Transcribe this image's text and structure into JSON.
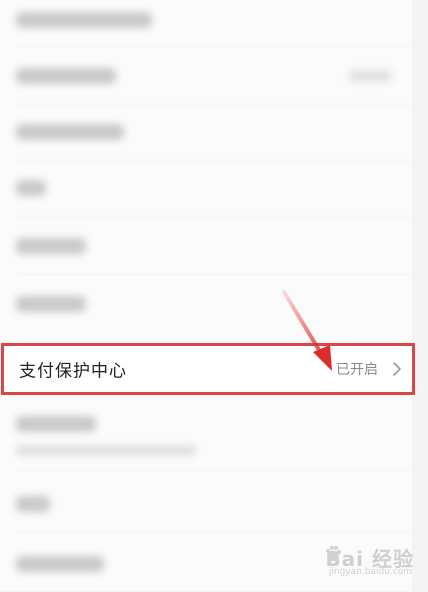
{
  "settings": {
    "highlighted_item": {
      "label": "支付保护中心",
      "status": "已开启"
    }
  },
  "watermark": {
    "brand": "Bai  经验",
    "url": "jingyan.baidu.com"
  },
  "colors": {
    "highlight_border": "#e04545",
    "arrow": "#e02b2b",
    "status_text": "#8a8a8a"
  },
  "icons": {
    "chevron": "chevron-right-icon",
    "watermark_logo": "baidu-paw-icon"
  }
}
